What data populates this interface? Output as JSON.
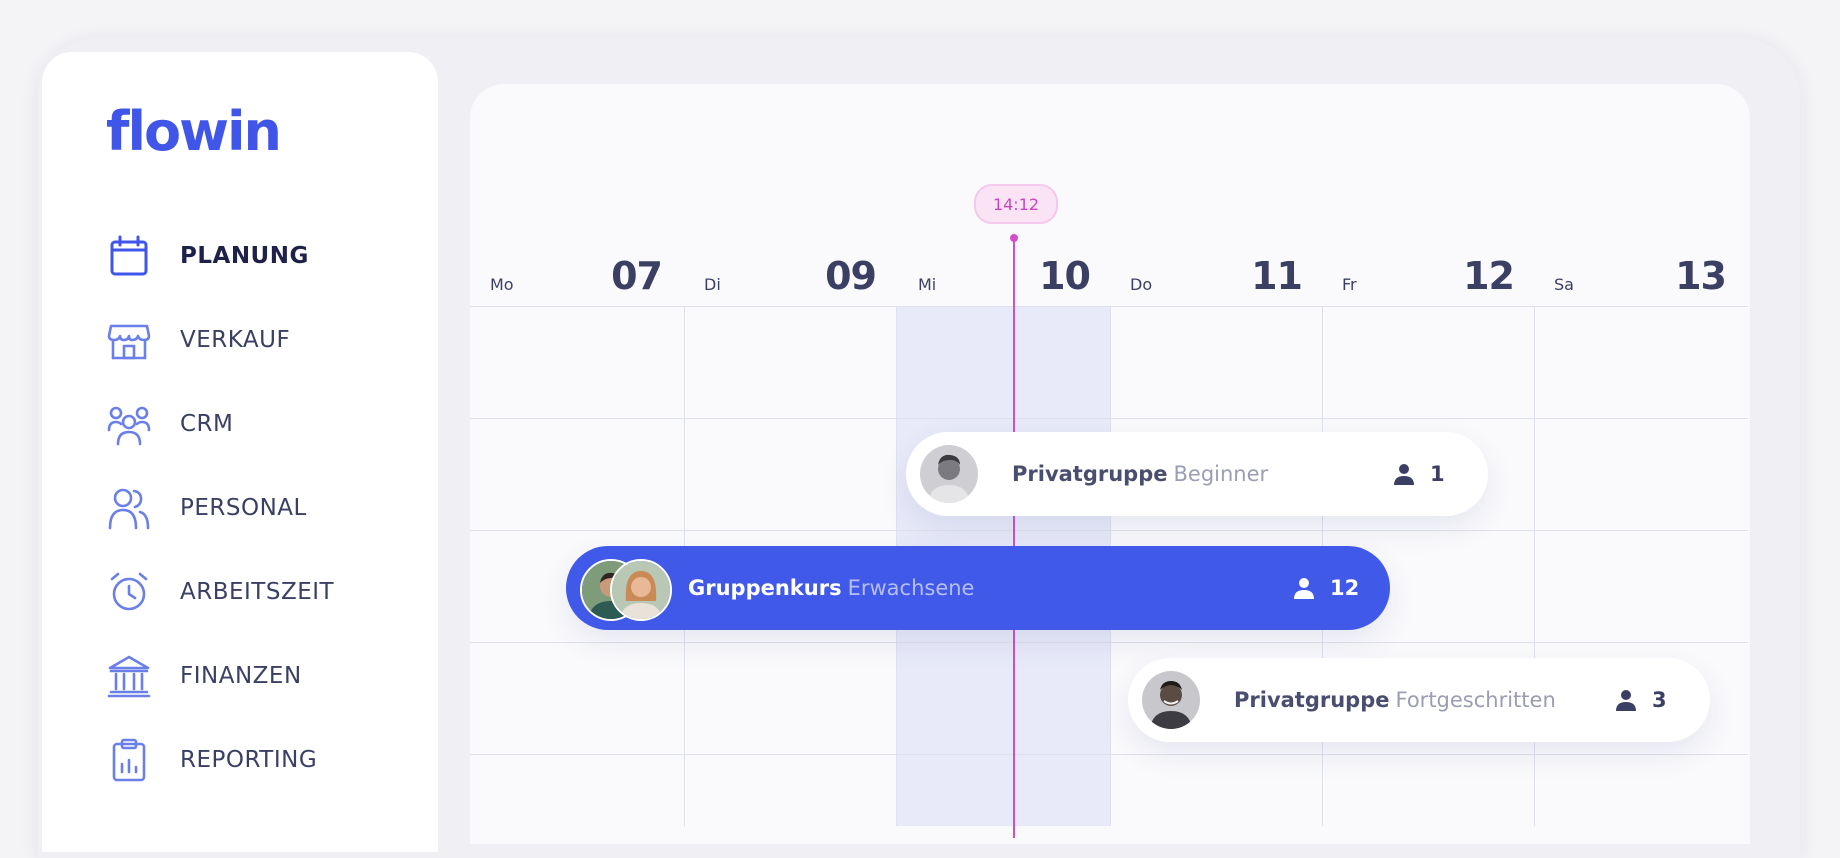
{
  "app": {
    "logo": "flowin"
  },
  "sidebar": {
    "items": [
      {
        "label": "PLANUNG",
        "icon": "calendar-icon"
      },
      {
        "label": "VERKAUF",
        "icon": "store-icon"
      },
      {
        "label": "CRM",
        "icon": "users-icon"
      },
      {
        "label": "PERSONAL",
        "icon": "staff-icon"
      },
      {
        "label": "ARBEITSZEIT",
        "icon": "alarm-clock-icon"
      },
      {
        "label": "FINANZEN",
        "icon": "bank-icon"
      },
      {
        "label": "REPORTING",
        "icon": "clipboard-chart-icon"
      }
    ]
  },
  "timeline": {
    "now": "14:12",
    "days": [
      {
        "name": "Mo",
        "num": "07"
      },
      {
        "name": "Di",
        "num": "09"
      },
      {
        "name": "Mi",
        "num": "10"
      },
      {
        "name": "Do",
        "num": "11"
      },
      {
        "name": "Fr",
        "num": "12"
      },
      {
        "name": "Sa",
        "num": "13"
      }
    ]
  },
  "events": [
    {
      "title": "Privatgruppe",
      "subtitle": "Beginner",
      "count": "1"
    },
    {
      "title": "Gruppenkurs",
      "subtitle": "Erwachsene",
      "count": "12"
    },
    {
      "title": "Privatgruppe",
      "subtitle": "Fortgeschritten",
      "count": "3"
    }
  ],
  "colors": {
    "accent": "#4159e8",
    "now_marker": "#d04fc9",
    "text": "#3b3f64"
  }
}
